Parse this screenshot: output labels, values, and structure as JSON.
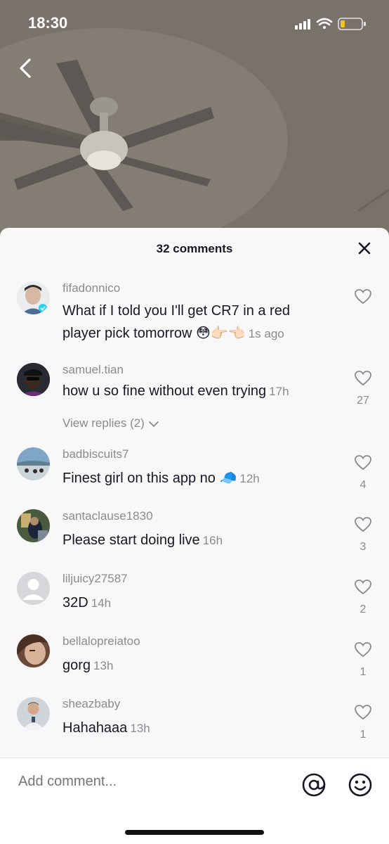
{
  "status_bar": {
    "time": "18:30"
  },
  "sheet": {
    "title": "32 comments"
  },
  "comments": [
    {
      "username": "fifadonnico",
      "text_line1": "What if I told you I'll get CR7 in a red",
      "text_line2": "player pick tomorrow 😳👉🏻👈🏻",
      "time": "1s ago",
      "likes": ""
    },
    {
      "username": "samuel.tian",
      "text": "how u so fine without even trying",
      "time": "17h",
      "likes": "27",
      "view_replies": "View replies (2)"
    },
    {
      "username": "badbiscuits7",
      "text": "Finest girl on this app no 🧢",
      "time": "12h",
      "likes": "4"
    },
    {
      "username": "santaclause1830",
      "text": "Please start doing live",
      "time": "16h",
      "likes": "3"
    },
    {
      "username": "liljuicy27587",
      "text": "32D",
      "time": "14h",
      "likes": "2"
    },
    {
      "username": "bellalopreiatoo",
      "text": "gorg",
      "time": "13h",
      "likes": "1"
    },
    {
      "username": "sheazbaby",
      "text": "Hahahaaa",
      "time": "13h",
      "likes": "1"
    }
  ],
  "input": {
    "placeholder": "Add comment..."
  },
  "icons": {
    "back": "chevron-left-icon",
    "close": "close-icon",
    "like": "heart-outline-icon",
    "mention": "at-icon",
    "emoji": "smiley-icon"
  }
}
